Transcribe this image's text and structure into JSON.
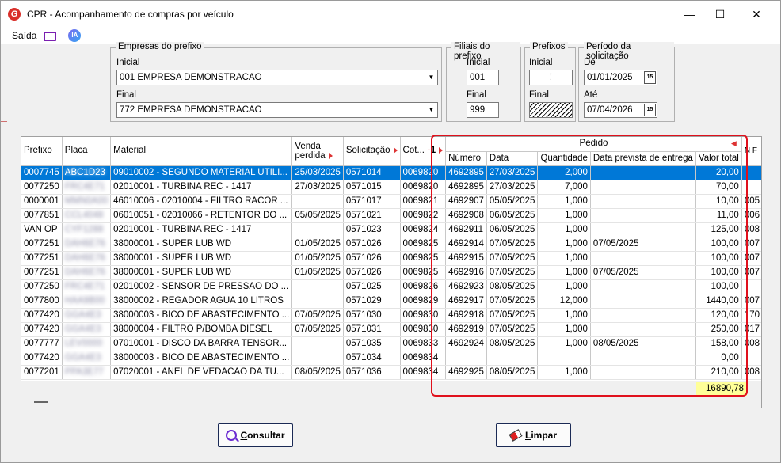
{
  "window": {
    "title": "CPR - Acompanhamento de compras por veículo",
    "minimize": "—",
    "maximize": "☐",
    "close": "✕"
  },
  "menu": {
    "saida": "Saída",
    "ia": "IA"
  },
  "empresas": {
    "group": "Empresas do prefixo",
    "inicial_label": "Inicial",
    "inicial_value": "001 EMPRESA DEMONSTRACAO",
    "final_label": "Final",
    "final_value": "772 EMPRESA DEMONSTRACAO"
  },
  "filiais": {
    "group": "Filiais do prefixo",
    "inicial_label": "Inicial",
    "inicial_value": "001",
    "final_label": "Final",
    "final_value": "999"
  },
  "prefixos": {
    "group": "Prefixos",
    "inicial_label": "Inicial",
    "inicial_value": "!",
    "final_label": "Final"
  },
  "periodo": {
    "group": "Período da solicitação",
    "de_label": "De",
    "de_value": "01/01/2025",
    "ate_label": "Até",
    "ate_value": "07/04/2026",
    "cal": "15"
  },
  "grid": {
    "headers": {
      "prefixo": "Prefixo",
      "placa": "Placa",
      "material": "Material",
      "venda": "Venda perdida",
      "solicitacao": "Solicitação",
      "cot": "Cot...",
      "cot_order": "1",
      "pedido": "Pedido",
      "numero": "Número",
      "data": "Data",
      "quantidade": "Quantidade",
      "data_prevista": "Data prevista de entrega",
      "valor_total": "Valor total",
      "next": "N F"
    },
    "rows": [
      [
        "0007745",
        "ABC1D23",
        "09010002 - SEGUNDO MATERIAL UTILI...",
        "25/03/2025",
        "0571014",
        "0069820",
        "4692895",
        "27/03/2025",
        "2,000",
        "",
        "20,00",
        ""
      ],
      [
        "0077250",
        "FRC4E71",
        "02010001 - TURBINA REC - 1417",
        "27/03/2025",
        "0571015",
        "0069820",
        "4692895",
        "27/03/2025",
        "7,000",
        "",
        "70,00",
        ""
      ],
      [
        "0000001",
        "MMN0A00",
        "46010006 - 02010004 - FILTRO RACOR ...",
        "",
        "0571017",
        "0069821",
        "4692907",
        "05/05/2025",
        "1,000",
        "",
        "10,00",
        "005"
      ],
      [
        "0077851",
        "CCL4048",
        "06010051 - 02010066 - RETENTOR DO ...",
        "05/05/2025",
        "0571021",
        "0069822",
        "4692908",
        "06/05/2025",
        "1,000",
        "",
        "11,00",
        "006"
      ],
      [
        "VAN OP",
        "CYF1288",
        "02010001 - TURBINA REC - 1417",
        "",
        "0571023",
        "0069824",
        "4692911",
        "06/05/2025",
        "1,000",
        "",
        "125,00",
        "008"
      ],
      [
        "0077251",
        "DAH6E76",
        "38000001 - SUPER LUB WD",
        "01/05/2025",
        "0571026",
        "0069825",
        "4692914",
        "07/05/2025",
        "1,000",
        "07/05/2025",
        "100,00",
        "007"
      ],
      [
        "0077251",
        "DAH6E76",
        "38000001 - SUPER LUB WD",
        "01/05/2025",
        "0571026",
        "0069825",
        "4692915",
        "07/05/2025",
        "1,000",
        "",
        "100,00",
        "007"
      ],
      [
        "0077251",
        "DAH6E76",
        "38000001 - SUPER LUB WD",
        "01/05/2025",
        "0571026",
        "0069825",
        "4692916",
        "07/05/2025",
        "1,000",
        "07/05/2025",
        "100,00",
        "007"
      ],
      [
        "0077250",
        "FRC4E71",
        "02010002 - SENSOR DE PRESSAO DO ...",
        "",
        "0571025",
        "0069826",
        "4692923",
        "08/05/2025",
        "1,000",
        "",
        "100,00",
        ""
      ],
      [
        "0077800",
        "HAA9B00",
        "38000002 - REGADOR AGUA 10 LITROS",
        "",
        "0571029",
        "0069829",
        "4692917",
        "07/05/2025",
        "12,000",
        "",
        "1440,00",
        "007"
      ],
      [
        "0077420",
        "GGA4E3",
        "38000003 - BICO DE ABASTECIMENTO ...",
        "07/05/2025",
        "0571030",
        "0069830",
        "4692918",
        "07/05/2025",
        "1,000",
        "",
        "120,00",
        "170"
      ],
      [
        "0077420",
        "GGA4E3",
        "38000004 - FILTRO P/BOMBA DIESEL",
        "07/05/2025",
        "0571031",
        "0069830",
        "4692919",
        "07/05/2025",
        "1,000",
        "",
        "250,00",
        "017"
      ],
      [
        "0077777",
        "LEV0000",
        "07010001 - DISCO DA BARRA TENSOR...",
        "",
        "0571035",
        "0069833",
        "4692924",
        "08/05/2025",
        "1,000",
        "08/05/2025",
        "158,00",
        "008"
      ],
      [
        "0077420",
        "GGA4E3",
        "38000003 - BICO DE ABASTECIMENTO ...",
        "",
        "0571034",
        "0069834",
        "",
        "",
        "",
        "",
        "0,00",
        ""
      ],
      [
        "0077201",
        "PPA3E77",
        "07020001 - ANEL DE VEDACAO DA TU...",
        "08/05/2025",
        "0571036",
        "0069834",
        "4692925",
        "08/05/2025",
        "1,000",
        "",
        "210,00",
        "008"
      ]
    ],
    "total": "16890,78"
  },
  "buttons": {
    "consultar": "Consultar",
    "limpar": "Limpar"
  }
}
